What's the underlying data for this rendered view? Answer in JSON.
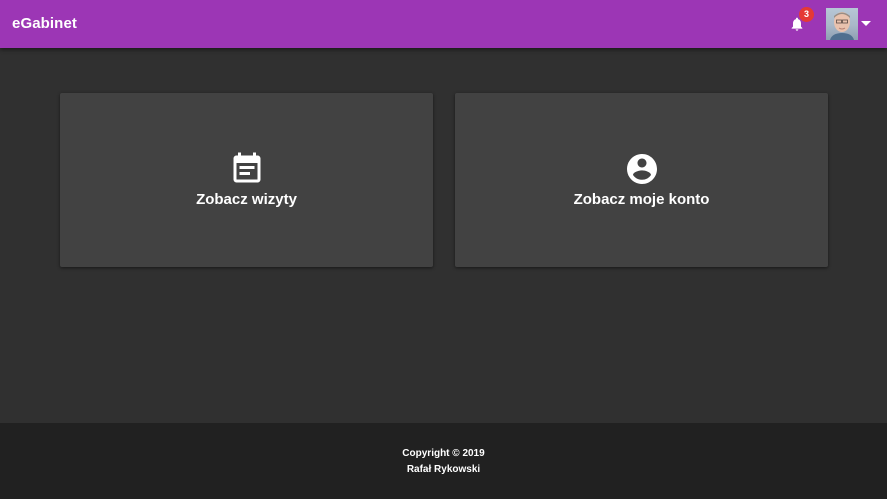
{
  "header": {
    "brand": "eGabinet",
    "notifications": {
      "icon": "bell-icon",
      "count": "3"
    },
    "account": {
      "avatar": "user-avatar",
      "menu_icon": "caret-down-icon"
    }
  },
  "cards": [
    {
      "label": "Zobacz wizyty",
      "icon": "calendar-icon"
    },
    {
      "label": "Zobacz moje konto",
      "icon": "account-circle-icon"
    }
  ],
  "footer": {
    "copyright": "Copyright © 2019",
    "author": "Rafał Rykowski"
  },
  "colors": {
    "toolbar": "#9c36b5",
    "background": "#303030",
    "card": "#424242",
    "footer": "#212121",
    "badge": "#e53935"
  }
}
